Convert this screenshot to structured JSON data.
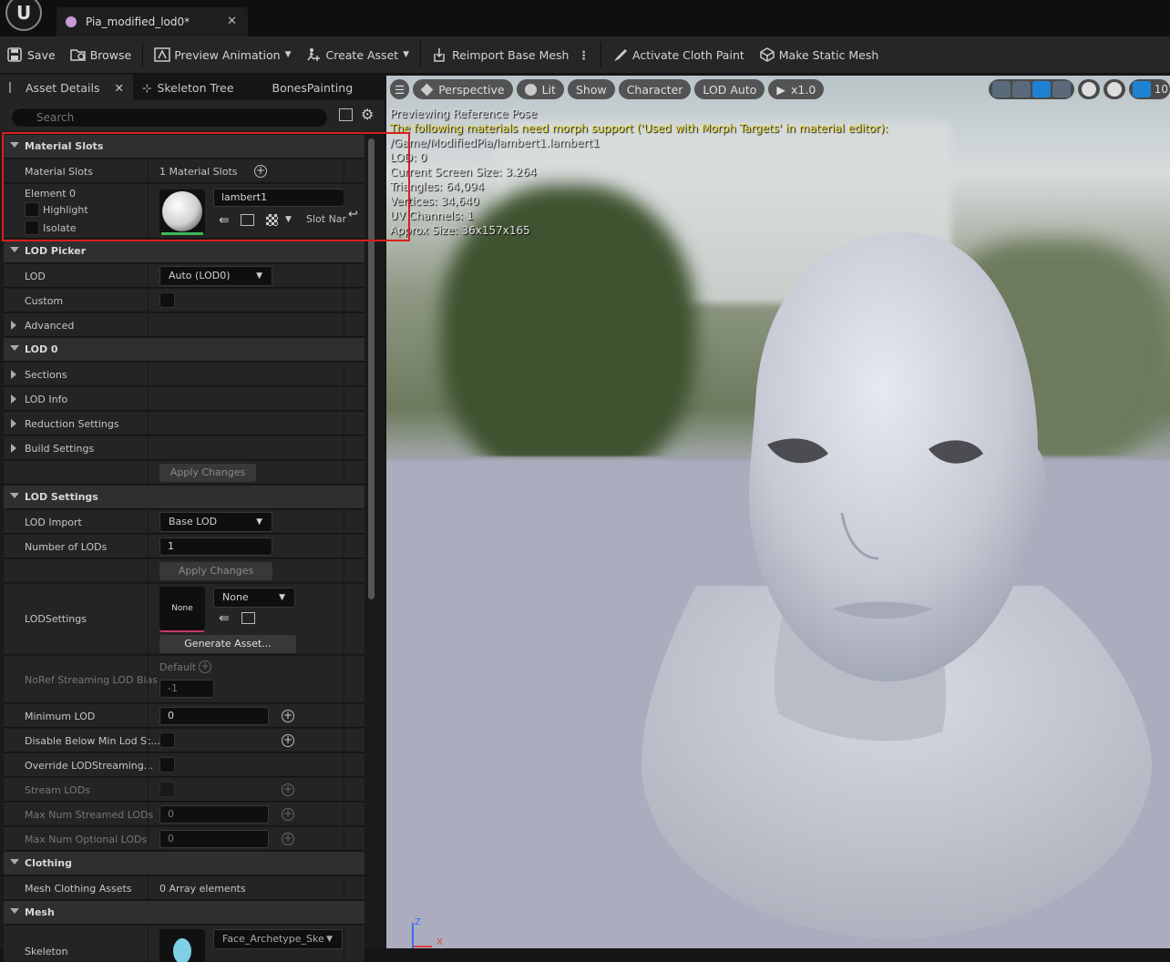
{
  "app": {
    "tab_title": "Pia_modified_lod0*",
    "close_glyph": "✕"
  },
  "toolbar": {
    "save": "Save",
    "browse": "Browse",
    "preview_animation": "Preview Animation",
    "create_asset": "Create Asset",
    "reimport_base_mesh": "Reimport Base Mesh",
    "activate_cloth_paint": "Activate Cloth Paint",
    "make_static_mesh": "Make Static Mesh"
  },
  "panel_tabs": {
    "asset_details": "Asset Details",
    "skeleton_tree": "Skeleton Tree",
    "bones_painting": "BonesPainting"
  },
  "search": {
    "placeholder": "Search"
  },
  "details": {
    "material_slots_cat": "Material Slots",
    "material_slots_label": "Material Slots",
    "material_slots_value": "1 Material Slots",
    "element0": "Element 0",
    "highlight": "Highlight",
    "isolate": "Isolate",
    "material_name": "lambert1",
    "slot_name": "Slot Nar",
    "lod_picker_cat": "LOD Picker",
    "lod_label": "LOD",
    "lod_value": "Auto (LOD0)",
    "custom_label": "Custom",
    "advanced_label": "Advanced",
    "lod0_cat": "LOD 0",
    "sections_label": "Sections",
    "lod_info_label": "LOD Info",
    "reduction_settings_label": "Reduction Settings",
    "build_settings_label": "Build Settings",
    "apply_changes": "Apply Changes",
    "lod_settings_cat": "LOD Settings",
    "lod_import_label": "LOD Import",
    "lod_import_value": "Base LOD",
    "number_of_lods_label": "Number of LODs",
    "number_of_lods_value": "1",
    "apply_changes2": "Apply Changes",
    "lodsettings_label": "LODSettings",
    "lodsettings_thumb": "None",
    "lodsettings_value": "None",
    "generate_asset": "Generate Asset...",
    "noref_label": "NoRef Streaming LOD Bias",
    "noref_default": "Default",
    "noref_value": "-1",
    "minimum_lod_label": "Minimum LOD",
    "minimum_lod_value": "0",
    "disable_below_label": "Disable Below Min Lod St...",
    "override_label": "Override LODStreaming...",
    "stream_lods_label": "Stream LODs",
    "max_streamed_label": "Max Num Streamed LODs",
    "max_streamed_value": "0",
    "max_optional_label": "Max Num Optional LODs",
    "max_optional_value": "0",
    "clothing_cat": "Clothing",
    "mesh_clothing_label": "Mesh Clothing Assets",
    "mesh_clothing_value": "0 Array elements",
    "mesh_cat": "Mesh",
    "skeleton_label": "Skeleton",
    "skeleton_value": "Face_Archetype_Ske"
  },
  "viewport": {
    "menu": "☰",
    "perspective": "Perspective",
    "lit": "Lit",
    "show": "Show",
    "character": "Character",
    "lod_auto": "LOD Auto",
    "speed": "x1.0",
    "grid_value": "10",
    "overlay_line1": "Previewing Reference Pose",
    "overlay_warning": "The following materials need morph support ('Used with Morph Targets' in material editor):",
    "overlay_path": "/Game/ModifiedPia/lambert1.lambert1",
    "overlay_lod": "LOD: 0",
    "overlay_screen_size": "Current Screen Size: 3.264",
    "overlay_triangles": "Triangles: 64,094",
    "overlay_vertices": "Vertices: 34,640",
    "overlay_uv": "UV Channels: 1",
    "overlay_approx": "Approx Size: 36x157x165",
    "axis_z": "Z",
    "axis_x": "X"
  },
  "colors": {
    "accent_blue": "#1e82d2",
    "highlight_red": "#d81e1e",
    "warning_yellow": "#f0e040",
    "material_green": "#3fb75a",
    "lodsettings_pink": "#c8386a"
  }
}
